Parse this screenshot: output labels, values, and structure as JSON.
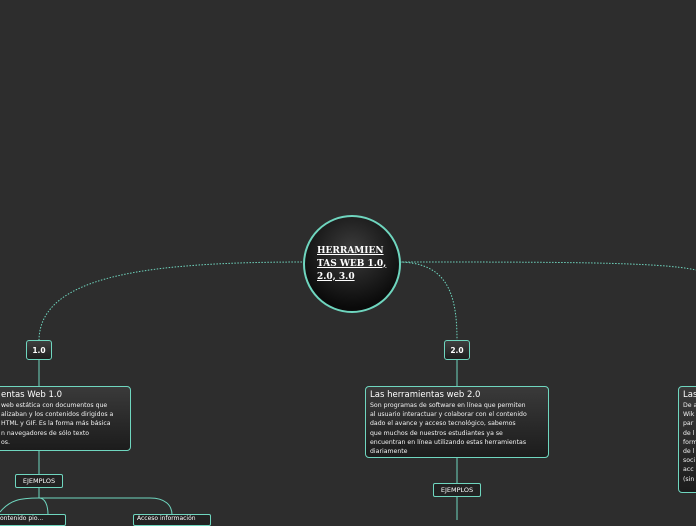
{
  "root": {
    "label": "HERRAMIENTAS WEB 1.0, 2.0, 3.0"
  },
  "badges": {
    "b1": "1.0",
    "b2": "2.0"
  },
  "topics": {
    "web1": {
      "title": "entas Web 1.0",
      "body": "web estática con documentos que\nalizaban y los contenidos dirigidos a\nHTML y GIF. Es la forma más básica\nn navegadores de sólo texto\nos."
    },
    "web2": {
      "title": "Las herramientas web 2.0",
      "body": "Son programas de software en línea que permiten\nal usuario interactuar y colaborar con el contenido\ndado el avance y acceso tecnológico, sabemos\nque muchos de nuestros estudiantes ya se\nencuentran en línea utilizando estas herramientas\ndiariamente"
    },
    "web3": {
      "title": "Las",
      "body": "De a\nWik\npar\nde l\nform\nde l\nsoci\nacc\n(sin"
    }
  },
  "examples": {
    "web1": "EJEMPLOS",
    "web2": "EJEMPLOS"
  },
  "leaves": {
    "leaf1": "ontenido pio...",
    "leaf2": "Acceso información"
  },
  "colors": {
    "accent": "#6fd6bf",
    "background": "#2d2d2d"
  }
}
